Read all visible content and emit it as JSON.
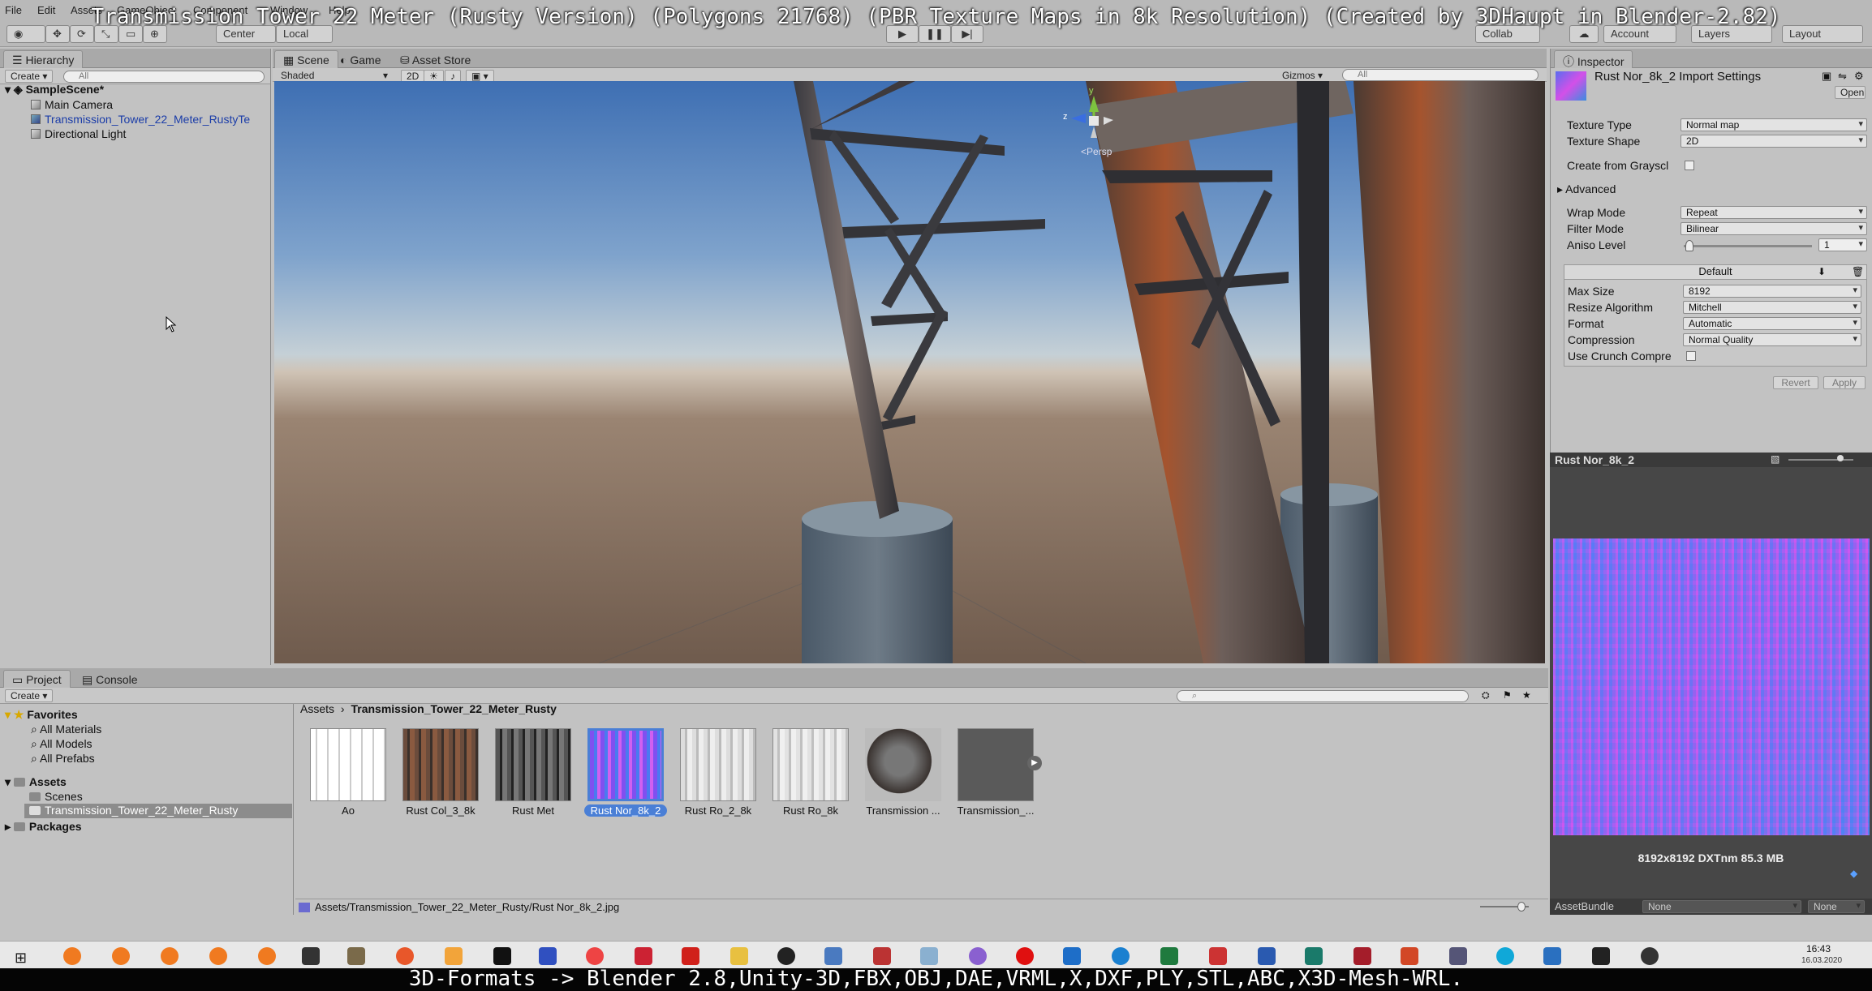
{
  "overlay": {
    "top_title": "Transmission Tower 22 Meter (Rusty Version) (Polygons 21768) (PBR Texture Maps in 8k Resolution) (Created by 3DHaupt in Blender-2.82)",
    "bottom_banner": "3D-Formats -> Blender 2.8,Unity-3D,FBX,OBJ,DAE,VRML,X,DXF,PLY,STL,ABC,X3D-Mesh-WRL."
  },
  "menu": [
    "File",
    "Edit",
    "Assets",
    "GameObject",
    "Component",
    "Window",
    "Help"
  ],
  "toolbar": {
    "center_label": "Center",
    "local_label": "Local",
    "collab_label": "Collab",
    "account_label": "Account",
    "layers_label": "Layers",
    "layout_label": "Layout"
  },
  "hierarchy": {
    "tab_label": "Hierarchy",
    "create_label": "Create",
    "search_placeholder": "All",
    "scene_name": "SampleScene*",
    "items": [
      "Main Camera",
      "Transmission_Tower_22_Meter_RustyTe",
      "Directional Light"
    ]
  },
  "scene": {
    "tabs": [
      "Scene",
      "Game",
      "Asset Store"
    ],
    "shading_mode": "Shaded",
    "mode_2d": "2D",
    "gizmos_label": "Gizmos",
    "search_placeholder": "All",
    "gizmo_y": "y",
    "gizmo_z": "z",
    "persp_label": "Persp"
  },
  "inspector": {
    "tab_label": "Inspector",
    "title": "Rust Nor_8k_2 Import Settings",
    "open_label": "Open",
    "texture_type_label": "Texture Type",
    "texture_type_value": "Normal map",
    "texture_shape_label": "Texture Shape",
    "texture_shape_value": "2D",
    "create_from_gray_label": "Create from Grayscl",
    "advanced_label": "Advanced",
    "wrap_mode_label": "Wrap Mode",
    "wrap_mode_value": "Repeat",
    "filter_mode_label": "Filter Mode",
    "filter_mode_value": "Bilinear",
    "aniso_label": "Aniso Level",
    "aniso_value": "1",
    "platform_label": "Default",
    "max_size_label": "Max Size",
    "max_size_value": "8192",
    "resize_label": "Resize Algorithm",
    "resize_value": "Mitchell",
    "format_label": "Format",
    "format_value": "Automatic",
    "compression_label": "Compression",
    "compression_value": "Normal Quality",
    "crunch_label": "Use Crunch Compre",
    "revert_label": "Revert",
    "apply_label": "Apply"
  },
  "preview": {
    "title": "Rust Nor_8k_2",
    "info": "8192x8192  DXTnm  85.3 MB",
    "assetbundle_label": "AssetBundle",
    "assetbundle_value": "None",
    "variant_value": "None"
  },
  "project": {
    "tabs": [
      "Project",
      "Console"
    ],
    "create_label": "Create",
    "favorites_label": "Favorites",
    "favorites": [
      "All Materials",
      "All Models",
      "All Prefabs"
    ],
    "assets_label": "Assets",
    "asset_folders": [
      "Scenes",
      "Transmission_Tower_22_Meter_Rusty"
    ],
    "packages_label": "Packages",
    "breadcrumb_root": "Assets",
    "breadcrumb_current": "Transmission_Tower_22_Meter_Rusty",
    "thumbnails": [
      "Ao",
      "Rust Col_3_8k",
      "Rust Met",
      "Rust Nor_8k_2",
      "Rust Ro_2_8k",
      "Rust Ro_8k",
      "Transmission ...",
      "Transmission_..."
    ],
    "status_path": "Assets/Transmission_Tower_22_Meter_Rusty/Rust Nor_8k_2.jpg"
  },
  "taskbar": {
    "time": "16:43",
    "date": "16.03.2020"
  }
}
